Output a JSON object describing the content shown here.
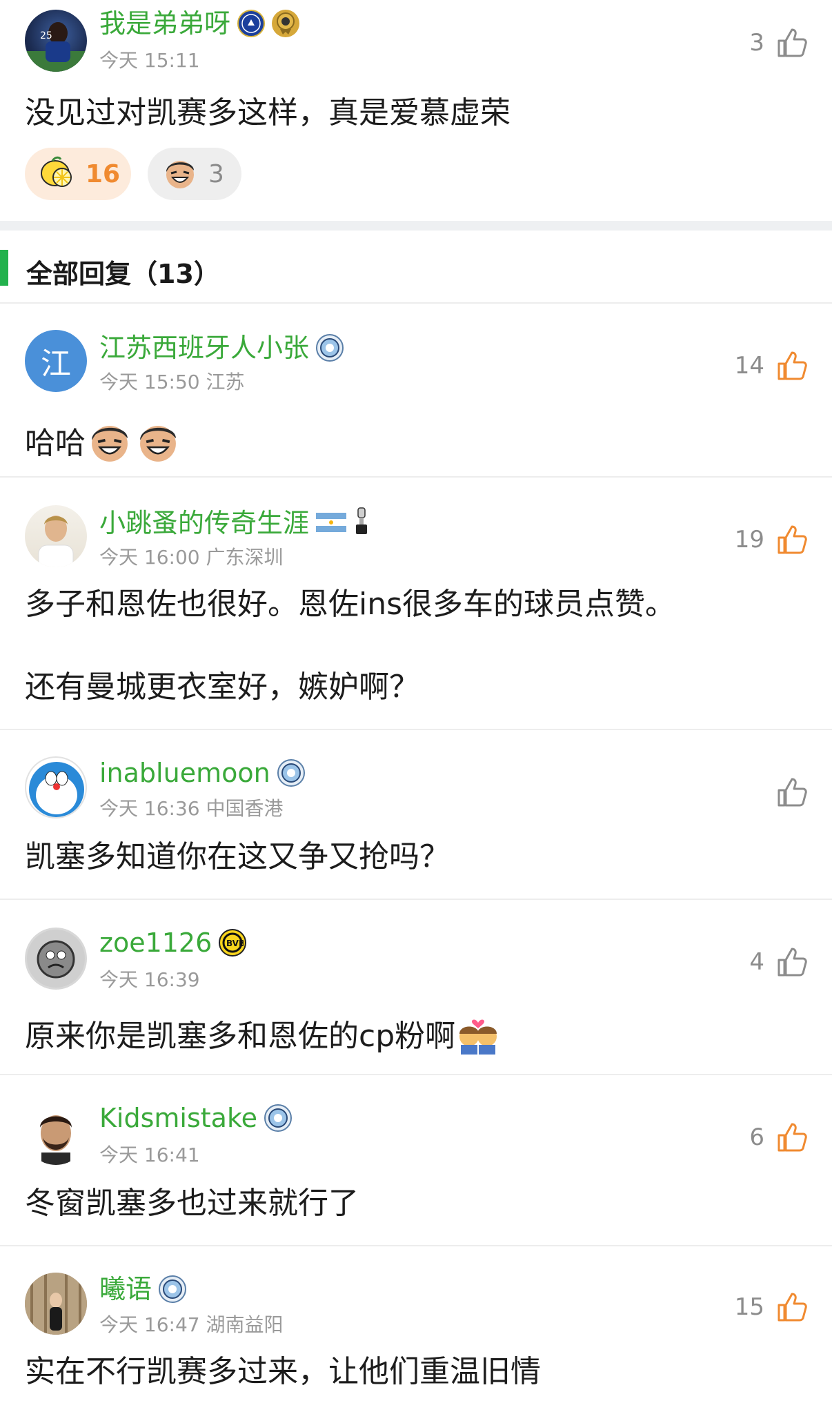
{
  "top_comment": {
    "username": "我是弟弟呀",
    "time": "今天 15:11",
    "likes": "3",
    "text": "没见过对凯赛多这样，真是爱慕虚荣",
    "reactions": [
      {
        "icon": "lemon-icon",
        "count": "16"
      },
      {
        "icon": "laughing-face-icon",
        "count": "3"
      }
    ]
  },
  "section": {
    "title": "全部回复（13）"
  },
  "replies": [
    {
      "username": "江苏西班牙人小张",
      "time": "今天 15:50 江苏",
      "likes": "14",
      "text": "哈哈",
      "avatar_char": "江"
    },
    {
      "username": "小跳蚤的传奇生涯",
      "time": "今天 16:00 广东深圳",
      "likes": "19",
      "text": "多子和恩佐也很好。恩佐ins很多车的球员点赞。",
      "text2": "还有曼城更衣室好，嫉妒啊？"
    },
    {
      "username": "inabluemoon",
      "time": "今天 16:36 中国香港",
      "likes": "",
      "text": "凯塞多知道你在这又争又抢吗？"
    },
    {
      "username": "zoe1126",
      "time": "今天 16:39",
      "likes": "4",
      "text": "原来你是凯塞多和恩佐的cp粉啊"
    },
    {
      "username": "Kidsmistake",
      "time": "今天 16:41",
      "likes": "6",
      "text": "冬窗凯塞多也过来就行了"
    },
    {
      "username": "曦语",
      "time": "今天 16:47 湖南益阳",
      "likes": "15",
      "text": "实在不行凯赛多过来，让他们重温旧情"
    }
  ],
  "colors": {
    "username": "#3aa93a",
    "like_active": "#f08a30",
    "like_inactive": "#8c8c8c",
    "section_bar": "#22b14c"
  }
}
